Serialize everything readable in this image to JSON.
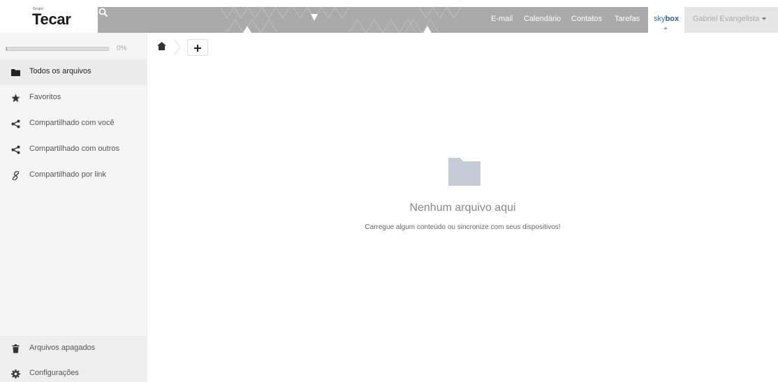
{
  "brand": {
    "small_text": "Grupo",
    "name": "Tecar"
  },
  "nav": {
    "links": [
      "E-mail",
      "Calendário",
      "Contatos",
      "Tarefas"
    ],
    "app_prefix": "sky",
    "app_suffix": "box",
    "user": "Gabriel Evangelista"
  },
  "quota": {
    "percent_label": "0%",
    "fraction": 0.0
  },
  "sidebar": {
    "items": [
      {
        "label": "Todos os arquivos",
        "icon": "folder-icon",
        "active": true
      },
      {
        "label": "Favoritos",
        "icon": "star-icon",
        "active": false
      },
      {
        "label": "Compartilhado com você",
        "icon": "share-icon",
        "active": false
      },
      {
        "label": "Compartilhado com outros",
        "icon": "share-icon",
        "active": false
      },
      {
        "label": "Compartilhado por link",
        "icon": "link-icon",
        "active": false
      }
    ],
    "bottom": [
      {
        "label": "Arquivos apagados",
        "icon": "trash-icon"
      },
      {
        "label": "Configurações",
        "icon": "gear-icon"
      }
    ]
  },
  "breadcrumb": {
    "home_icon": "home-icon",
    "add_icon": "plus-icon"
  },
  "empty": {
    "title": "Nenhum arquivo aqui",
    "subtitle": "Carregue algum conteúdo ou sincronize com seus dispositivos!"
  },
  "colors": {
    "header_bar": "#aaaaaa",
    "sidebar_bg": "#f5f5f5",
    "accent": "#3a6ea5",
    "folder": "#c5ccd8"
  }
}
